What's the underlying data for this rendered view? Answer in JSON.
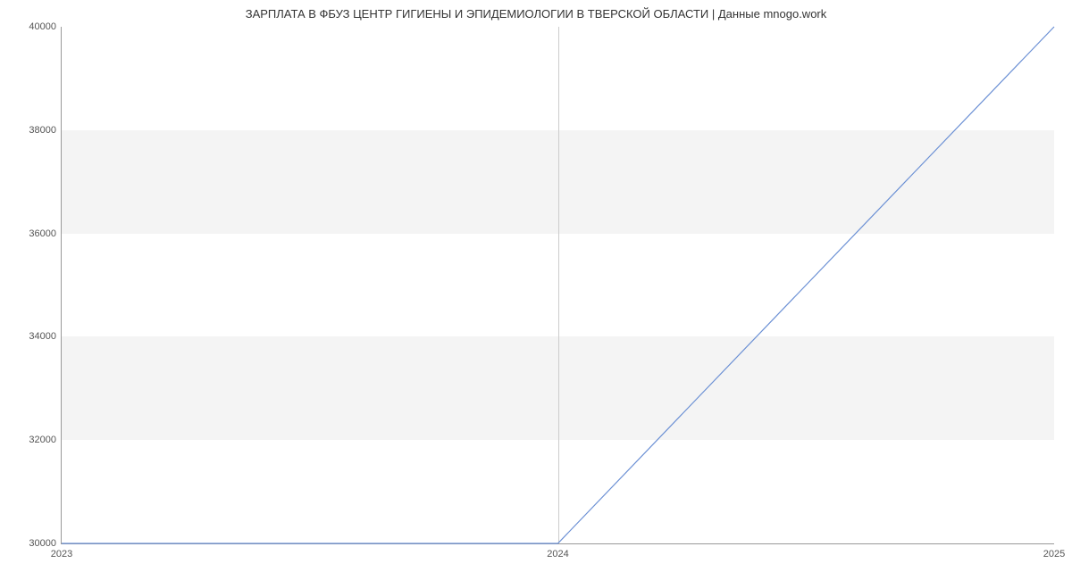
{
  "chart_data": {
    "type": "line",
    "title": "ЗАРПЛАТА В ФБУЗ ЦЕНТР ГИГИЕНЫ И ЭПИДЕМИОЛОГИИ В ТВЕРСКОЙ ОБЛАСТИ | Данные mnogo.work",
    "x": [
      2023,
      2024,
      2025
    ],
    "values": [
      30000,
      30000,
      40000
    ],
    "xticks": [
      "2023",
      "2024",
      "2025"
    ],
    "yticks": [
      "30000",
      "32000",
      "34000",
      "36000",
      "38000",
      "40000"
    ],
    "ylim": [
      30000,
      40000
    ],
    "xlim": [
      2023,
      2025
    ],
    "xlabel": "",
    "ylabel": ""
  }
}
